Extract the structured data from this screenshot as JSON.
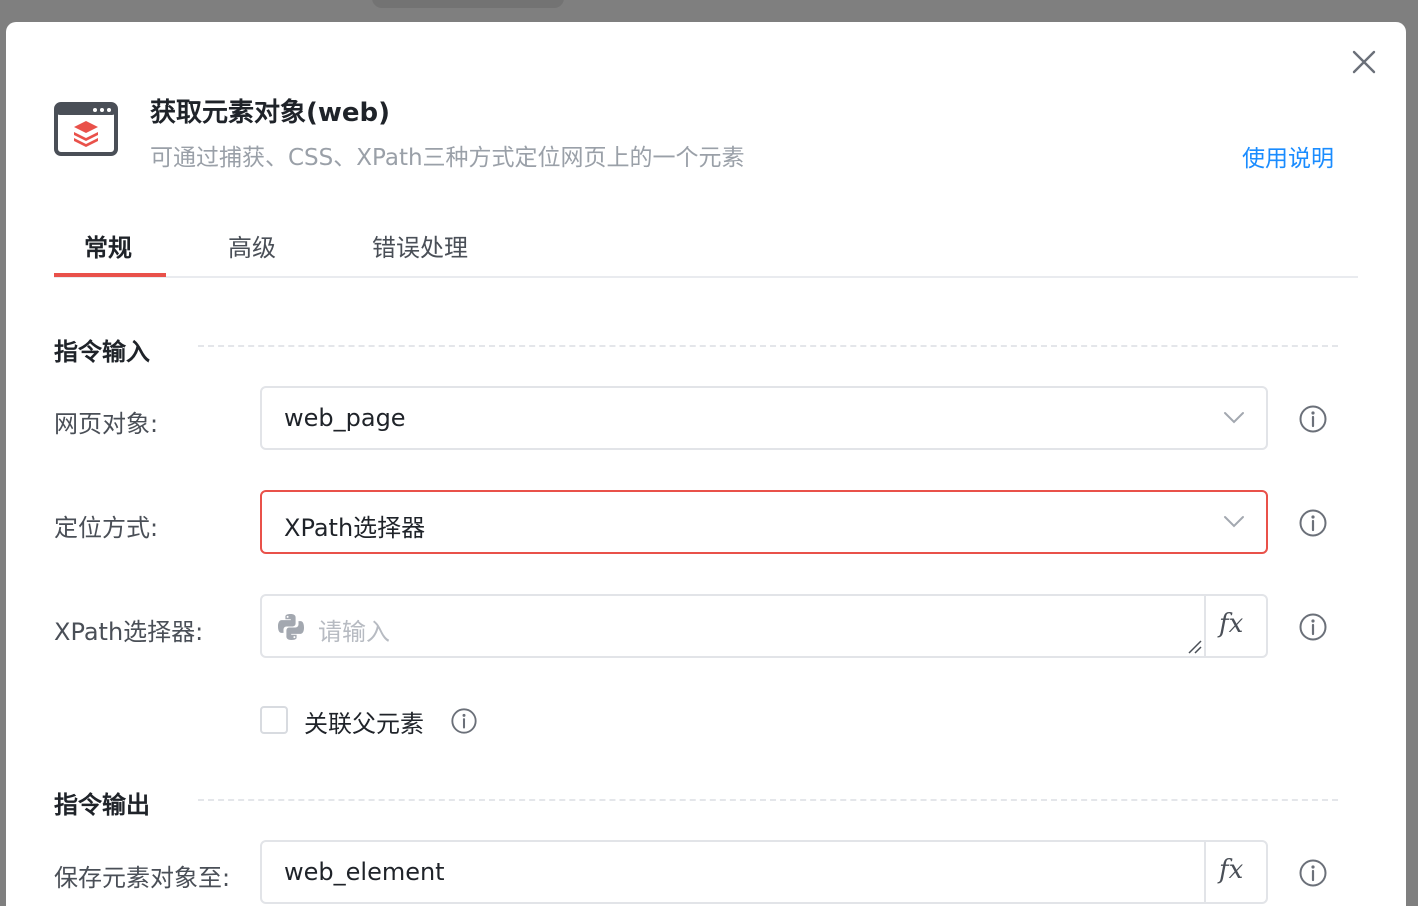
{
  "dialog": {
    "title": "获取元素对象(web)",
    "subtitle": "可通过捕获、CSS、XPath三种方式定位网页上的一个元素",
    "help_link": "使用说明",
    "app_icon": "web-element-icon",
    "close_icon": "close-icon"
  },
  "tabs": [
    {
      "label": "常规",
      "active": true
    },
    {
      "label": "高级",
      "active": false
    },
    {
      "label": "错误处理",
      "active": false
    }
  ],
  "input_section": {
    "title": "指令输入",
    "web_page": {
      "label": "网页对象:",
      "value": "web_page"
    },
    "locate_method": {
      "label": "定位方式:",
      "value": "XPath选择器"
    },
    "xpath": {
      "label": "XPath选择器:",
      "placeholder": "请输入",
      "fx": "fx"
    },
    "link_parent": {
      "label": "关联父元素",
      "checked": false
    }
  },
  "output_section": {
    "title": "指令输出",
    "save_to": {
      "label": "保存元素对象至:",
      "value": "web_element",
      "fx": "fx"
    }
  },
  "colors": {
    "accent": "#e9514a",
    "link": "#1a8cff"
  }
}
